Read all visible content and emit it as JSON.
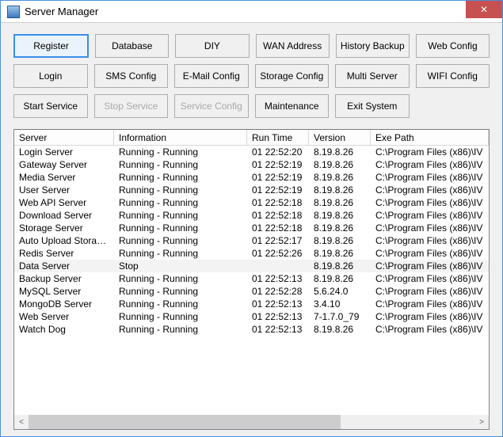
{
  "window": {
    "title": "Server Manager",
    "close_label": "✕"
  },
  "buttons": {
    "row1": [
      "Register",
      "Database",
      "DIY",
      "WAN Address",
      "History Backup",
      "Web Config"
    ],
    "row2": [
      "Login",
      "SMS Config",
      "E-Mail Config",
      "Storage Config",
      "Multi Server",
      "WIFI Config"
    ],
    "row3": [
      "Start Service",
      "Stop Service",
      "Service Config",
      "Maintenance",
      "Exit System",
      ""
    ],
    "selected": "Register",
    "disabled": [
      "Stop Service",
      "Service Config"
    ]
  },
  "table": {
    "columns": [
      "Server",
      "Information",
      "Run Time",
      "Version",
      "Exe Path"
    ],
    "rows": [
      {
        "server": "Login Server",
        "info": "Running - Running",
        "runtime": "01 22:52:20",
        "version": "8.19.8.26",
        "exe": "C:\\Program Files (x86)\\IV",
        "stopped": false
      },
      {
        "server": "Gateway Server",
        "info": "Running - Running",
        "runtime": "01 22:52:19",
        "version": "8.19.8.26",
        "exe": "C:\\Program Files (x86)\\IV",
        "stopped": false
      },
      {
        "server": "Media Server",
        "info": "Running - Running",
        "runtime": "01 22:52:19",
        "version": "8.19.8.26",
        "exe": "C:\\Program Files (x86)\\IV",
        "stopped": false
      },
      {
        "server": "User Server",
        "info": "Running - Running",
        "runtime": "01 22:52:19",
        "version": "8.19.8.26",
        "exe": "C:\\Program Files (x86)\\IV",
        "stopped": false
      },
      {
        "server": "Web API Server",
        "info": "Running - Running",
        "runtime": "01 22:52:18",
        "version": "8.19.8.26",
        "exe": "C:\\Program Files (x86)\\IV",
        "stopped": false
      },
      {
        "server": "Download Server",
        "info": "Running - Running",
        "runtime": "01 22:52:18",
        "version": "8.19.8.26",
        "exe": "C:\\Program Files (x86)\\IV",
        "stopped": false
      },
      {
        "server": "Storage Server",
        "info": "Running - Running",
        "runtime": "01 22:52:18",
        "version": "8.19.8.26",
        "exe": "C:\\Program Files (x86)\\IV",
        "stopped": false
      },
      {
        "server": "Auto Upload Storage S...",
        "info": "Running - Running",
        "runtime": "01 22:52:17",
        "version": "8.19.8.26",
        "exe": "C:\\Program Files (x86)\\IV",
        "stopped": false
      },
      {
        "server": "Redis Server",
        "info": "Running - Running",
        "runtime": "01 22:52:26",
        "version": "8.19.8.26",
        "exe": "C:\\Program Files (x86)\\IV",
        "stopped": false
      },
      {
        "server": "Data Server",
        "info": "Stop",
        "runtime": "",
        "version": "8.19.8.26",
        "exe": "C:\\Program Files (x86)\\IV",
        "stopped": true
      },
      {
        "server": "Backup Server",
        "info": "Running - Running",
        "runtime": "01 22:52:13",
        "version": "8.19.8.26",
        "exe": "C:\\Program Files (x86)\\IV",
        "stopped": false
      },
      {
        "server": "MySQL Server",
        "info": "Running - Running",
        "runtime": "01 22:52:28",
        "version": "5.6.24.0",
        "exe": "C:\\Program Files (x86)\\IV",
        "stopped": false
      },
      {
        "server": "MongoDB Server",
        "info": "Running - Running",
        "runtime": "01 22:52:13",
        "version": "3.4.10",
        "exe": "C:\\Program Files (x86)\\IV",
        "stopped": false
      },
      {
        "server": "Web Server",
        "info": "Running - Running",
        "runtime": "01 22:52:13",
        "version": "7-1.7.0_79",
        "exe": "C:\\Program Files (x86)\\IV",
        "stopped": false
      },
      {
        "server": "Watch Dog",
        "info": "Running - Running",
        "runtime": "01 22:52:13",
        "version": "8.19.8.26",
        "exe": "C:\\Program Files (x86)\\IV",
        "stopped": false
      }
    ]
  },
  "scroll": {
    "left_label": "<",
    "right_label": ">"
  }
}
